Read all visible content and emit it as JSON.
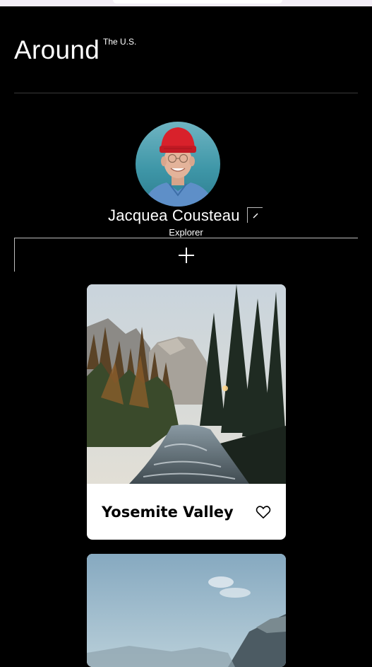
{
  "browser": {
    "chrome": "top-strip"
  },
  "header": {
    "logo_main": "Around",
    "logo_sup": "The U.S."
  },
  "profile": {
    "name": "Jacquea Cousteau",
    "role": "Explorer",
    "avatar_alt": "Jacquea Cousteau"
  },
  "actions": {
    "edit_icon": "pencil-icon",
    "add_icon": "plus-icon"
  },
  "cards": [
    {
      "title": "Yosemite Valley",
      "image": "forest-river-photo",
      "like_icon": "heart-outline-icon"
    },
    {
      "title": "",
      "image": "mountain-lake-photo",
      "like_icon": "heart-outline-icon"
    }
  ],
  "colors": {
    "page_bg": "#000000",
    "text": "#ffffff",
    "card_bg": "#ffffff",
    "card_title": "#000000",
    "divider": "#3a3a3a"
  }
}
